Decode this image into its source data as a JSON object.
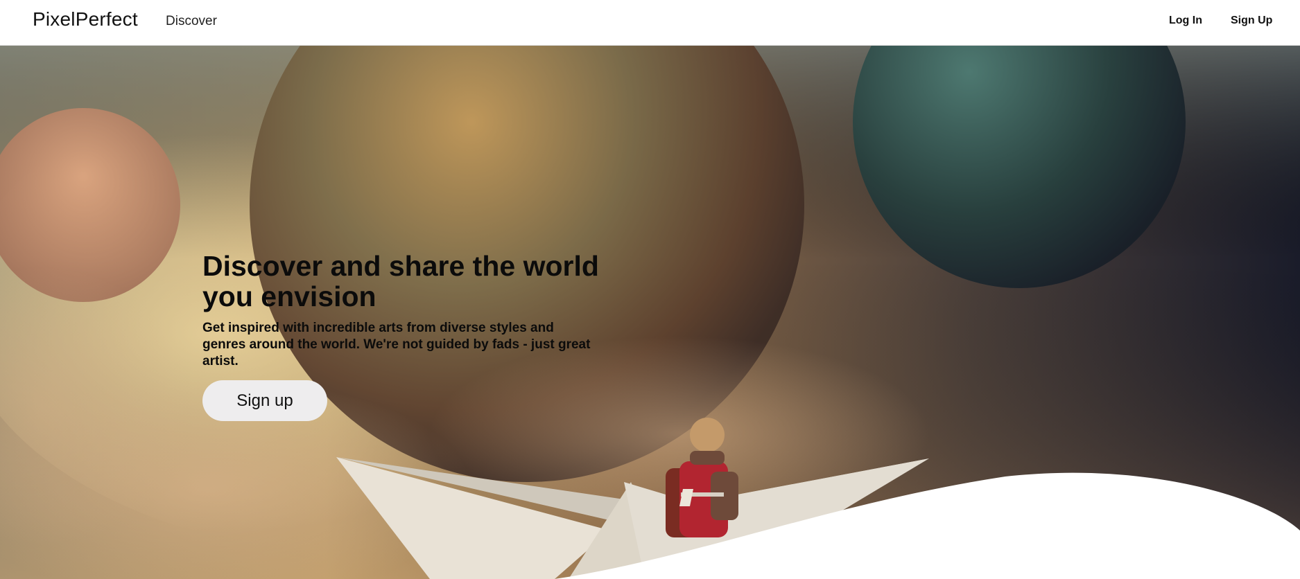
{
  "navbar": {
    "brand": "PixelPerfect",
    "discover": "Discover",
    "login": "Log In",
    "signup": "Sign Up"
  },
  "hero": {
    "title_line1": "Discover and share the world",
    "title_line2": "you envision",
    "subtitle": "Get inspired with incredible arts from diverse styles and genres around the world. We're not guided by fads - just great artist.",
    "cta_label": "Sign up"
  },
  "colors": {
    "button_bg": "#eeedee",
    "text": "#0b0b0b",
    "nav_bg": "#ffffff"
  }
}
